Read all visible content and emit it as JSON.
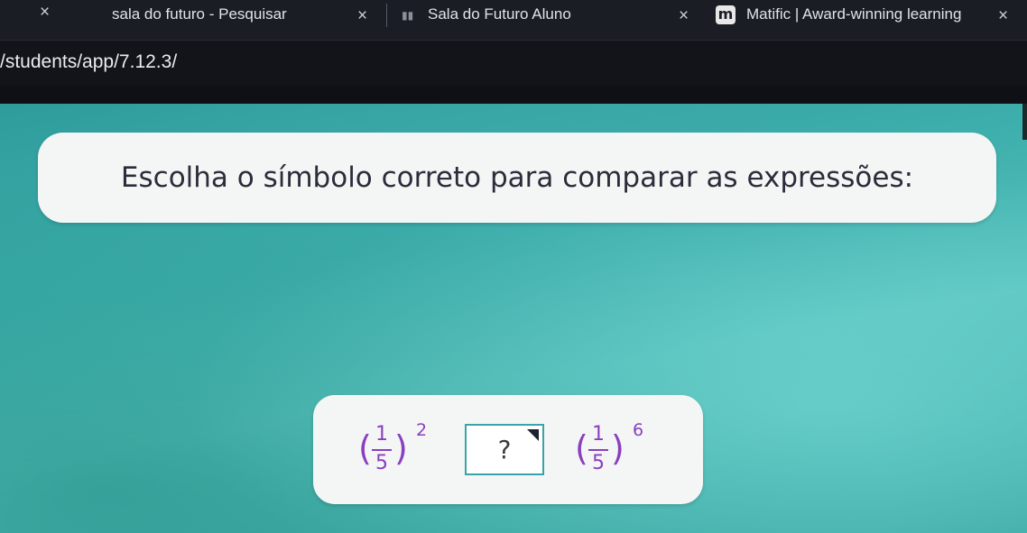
{
  "browser": {
    "tabs": [
      {
        "title": "sala do futuro - Pesquisar",
        "close": "×"
      },
      {
        "title": "Sala do Futuro Aluno",
        "close": "×"
      },
      {
        "title": "Matific | Award-winning learning",
        "close": "×"
      }
    ],
    "first_close": "×",
    "matific_icon_letter": "m",
    "address": "/students/app/7.12.3/"
  },
  "question": {
    "text": "Escolha o símbolo correto para comparar as expressões:"
  },
  "expression": {
    "left": {
      "numerator": "1",
      "denominator": "5",
      "exponent": "2",
      "open_paren": "(",
      "close_paren": ")"
    },
    "selector_value": "?",
    "right": {
      "numerator": "1",
      "denominator": "5",
      "exponent": "6",
      "open_paren": "(",
      "close_paren": ")"
    }
  },
  "colors": {
    "fraction": "#8a3fbf",
    "background_teal": "#3fb0ad",
    "selector_border": "#3aa3a9"
  }
}
